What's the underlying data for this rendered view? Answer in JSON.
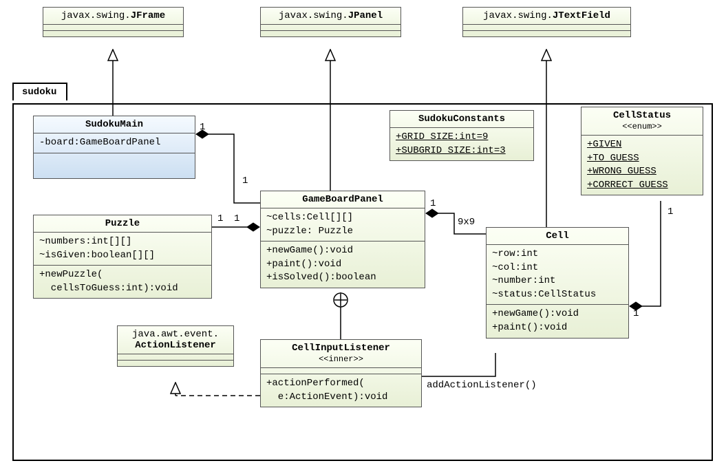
{
  "package": {
    "name": "sudoku"
  },
  "externals": {
    "jframe": {
      "pkg": "javax.swing.",
      "cls": "JFrame"
    },
    "jpanel": {
      "pkg": "javax.swing.",
      "cls": "JPanel"
    },
    "jtextfield": {
      "pkg": "javax.swing.",
      "cls": "JTextField"
    },
    "actionlistener": {
      "pkg": "java.awt.event.",
      "cls": "ActionListener"
    }
  },
  "classes": {
    "sudokumain": {
      "name": "SudokuMain",
      "attrs": "-board:GameBoardPanel"
    },
    "gameboardpanel": {
      "name": "GameBoardPanel",
      "attrs": "~cells:Cell[][]\n~puzzle: Puzzle",
      "ops": "+newGame():void\n+paint():void\n+isSolved():boolean"
    },
    "puzzle": {
      "name": "Puzzle",
      "attrs": "~numbers:int[][]\n~isGiven:boolean[][]",
      "ops": "+newPuzzle(\n  cellsToGuess:int):void"
    },
    "cell": {
      "name": "Cell",
      "attrs": "~row:int\n~col:int\n~number:int\n~status:CellStatus",
      "ops": "+newGame():void\n+paint():void"
    },
    "cellinputlistener": {
      "name": "CellInputListener",
      "stereo": "<<inner>>",
      "ops": "+actionPerformed(\n  e:ActionEvent):void"
    },
    "sudokuconstants": {
      "name": "SudokuConstants",
      "attr1": "+GRID_SIZE:int=9",
      "attr2": "+SUBGRID_SIZE:int=3"
    },
    "cellstatus": {
      "name": "CellStatus",
      "stereo": "<<enum>>",
      "v1": "+GIVEN",
      "v2": "+TO_GUESS",
      "v3": "+WRONG_GUESS",
      "v4": "+CORRECT_GUESS"
    }
  },
  "mult": {
    "sm_gbp_src": "1",
    "sm_gbp_dst": "1",
    "gbp_puzzle_src": "1",
    "gbp_puzzle_dst": "1",
    "gbp_cell_src": "1",
    "gbp_cell_dst": "9x9",
    "cell_status_src": "1",
    "cell_status_dst": "1"
  },
  "assoc": {
    "addActionListener": "addActionListener()"
  }
}
